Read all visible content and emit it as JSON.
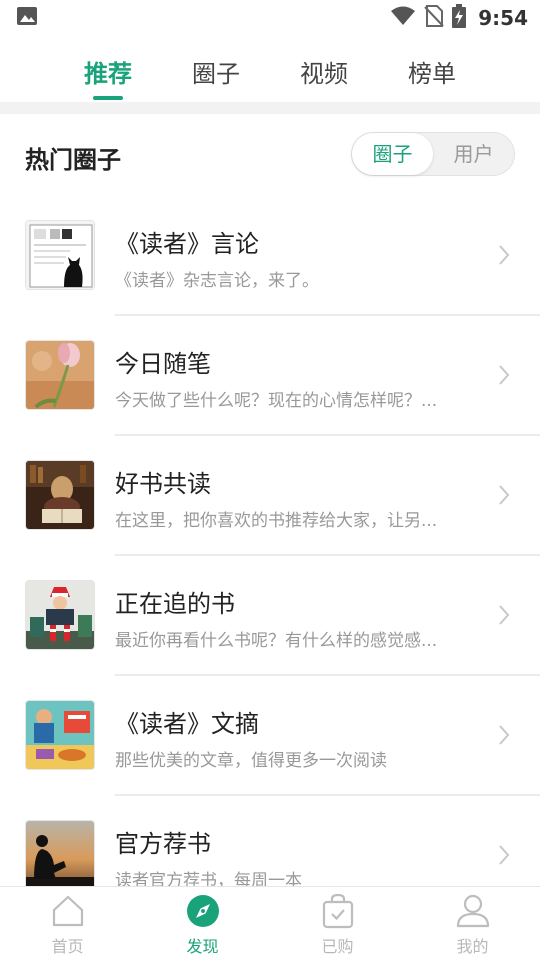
{
  "status_bar": {
    "time": "9:54",
    "icons": [
      "image-icon",
      "wifi-icon",
      "no-sim-icon",
      "battery-charging-icon"
    ]
  },
  "top_tabs": [
    {
      "label": "推荐",
      "active": true
    },
    {
      "label": "圈子",
      "active": false
    },
    {
      "label": "视频",
      "active": false
    },
    {
      "label": "榜单",
      "active": false
    }
  ],
  "section": {
    "title": "热门圈子",
    "segments": [
      {
        "label": "圈子",
        "active": true
      },
      {
        "label": "用户",
        "active": false
      }
    ]
  },
  "circles": [
    {
      "title": "《读者》言论",
      "desc": "《读者》杂志言论，来了。",
      "thumb": "newspaper-cat-image"
    },
    {
      "title": "今日随笔",
      "desc": "今天做了些什么呢？现在的心情怎样呢？...",
      "thumb": "tulip-image"
    },
    {
      "title": "好书共读",
      "desc": "在这里，把你喜欢的书推荐给大家，让另...",
      "thumb": "reading-man-image"
    },
    {
      "title": "正在追的书",
      "desc": "最近你再看什么书呢？有什么样的感觉感...",
      "thumb": "child-reading-image"
    },
    {
      "title": "《读者》文摘",
      "desc": "那些优美的文章，值得更多一次阅读",
      "thumb": "illustration-image"
    },
    {
      "title": "官方荐书",
      "desc": "读者官方荐书，每周一本",
      "thumb": "silhouette-reading-image"
    }
  ],
  "bottom_nav": [
    {
      "label": "首页",
      "icon": "home-icon",
      "active": false
    },
    {
      "label": "发现",
      "icon": "compass-icon",
      "active": true
    },
    {
      "label": "已购",
      "icon": "purchased-bag-icon",
      "active": false
    },
    {
      "label": "我的",
      "icon": "profile-icon",
      "active": false
    }
  ],
  "colors": {
    "accent": "#1aa37a",
    "muted": "#999999",
    "inactive_nav": "#b8b8b8"
  }
}
